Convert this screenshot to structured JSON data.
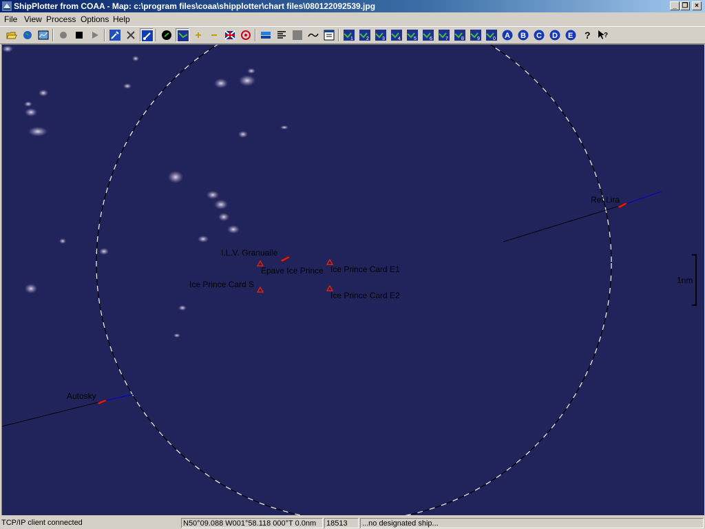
{
  "window": {
    "title": "ShipPlotter from COAA - Map: c:\\program files\\coaa\\shipplotter\\chart files\\080122092539.jpg",
    "controls": [
      "minimize",
      "restore",
      "close"
    ]
  },
  "menu": [
    {
      "label": "File"
    },
    {
      "label": "View"
    },
    {
      "label": "Process"
    },
    {
      "label": "Options"
    },
    {
      "label": "Help"
    }
  ],
  "toolbar": {
    "numbered_buttons": [
      "1",
      "2",
      "3",
      "4",
      "5",
      "6",
      "7",
      "8",
      "9",
      "0"
    ],
    "letter_buttons": [
      "A",
      "B",
      "C",
      "D",
      "E"
    ],
    "icons": [
      "open-folder-icon",
      "globe-icon",
      "chart-icon",
      "record-icon",
      "stop-icon",
      "play-icon",
      "wrench-icon",
      "tools-icon",
      "link-icon",
      "ship-icon",
      "map-icon",
      "zoom-in-icon",
      "zoom-out-icon",
      "flag-icon",
      "target-icon",
      "layers-icon",
      "text-align-icon",
      "gray-square-icon",
      "track-icon",
      "window-icon",
      "help-icon",
      "context-help-icon"
    ]
  },
  "map": {
    "scale_label": "1nm",
    "ships": [
      {
        "name": "Ref Lira"
      },
      {
        "name": "I.L.V. Granuaile"
      },
      {
        "name": "Autosky"
      }
    ],
    "markers": [
      {
        "name": "Epave Ice Prince"
      },
      {
        "name": "Ice Prince Card E1"
      },
      {
        "name": "Ice Prince Card S"
      },
      {
        "name": "Ice Prince Card E2"
      }
    ],
    "colors": {
      "sea": "#21245a",
      "ship": "#e02010",
      "heading_line": "#0000cc",
      "track_line": "#000000",
      "range_ring": "#ffffff"
    }
  },
  "status": {
    "connection": "TCP/IP client connected",
    "position": "N50°09.088 W001°58.118 000°T 0.0nm",
    "count": "18513",
    "designated": "...no designated ship..."
  }
}
